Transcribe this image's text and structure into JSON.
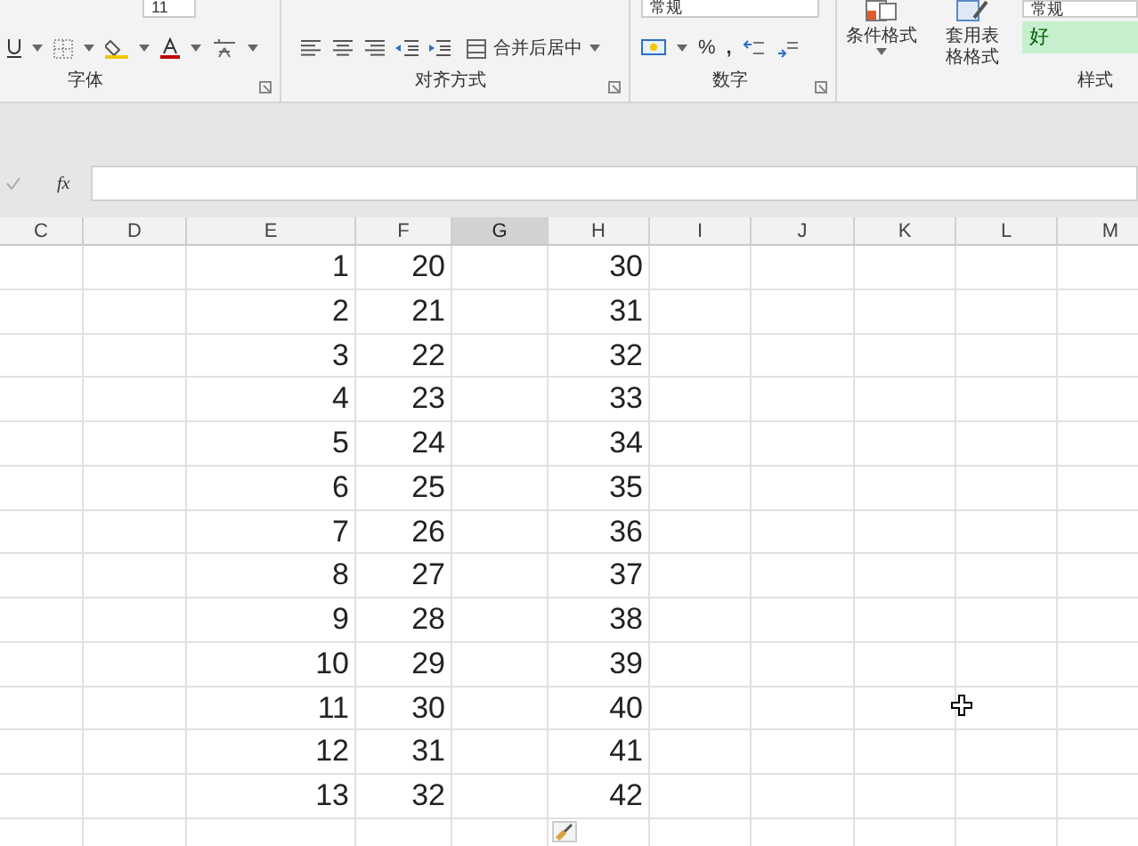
{
  "ribbon": {
    "font_size": "11",
    "number_format": "常规",
    "merge_button": "合并后居中",
    "percent_button": "%",
    "comma_button": ",",
    "conditional_format": "条件格式",
    "format_as_table": "套用表格格式",
    "style_normal": "常规",
    "style_good": "好",
    "groups": [
      "字体",
      "对齐方式",
      "数字",
      "样式"
    ]
  },
  "formula_bar": {
    "fx": "fx"
  },
  "columns": [
    {
      "label": "C",
      "selected": false
    },
    {
      "label": "D",
      "selected": false
    },
    {
      "label": "E",
      "selected": false
    },
    {
      "label": "F",
      "selected": false
    },
    {
      "label": "G",
      "selected": true
    },
    {
      "label": "H",
      "selected": false
    },
    {
      "label": "I",
      "selected": false
    },
    {
      "label": "J",
      "selected": false
    },
    {
      "label": "K",
      "selected": false
    },
    {
      "label": "L",
      "selected": false
    },
    {
      "label": "M",
      "selected": false
    }
  ],
  "rows": [
    {
      "column_e": "1",
      "column_f": "20",
      "column_h": "30"
    },
    {
      "column_e": "2",
      "column_f": "21",
      "column_h": "31"
    },
    {
      "column_e": "3",
      "column_f": "22",
      "column_h": "32"
    },
    {
      "column_e": "4",
      "column_f": "23",
      "column_h": "33"
    },
    {
      "column_e": "5",
      "column_f": "24",
      "column_h": "34"
    },
    {
      "column_e": "6",
      "column_f": "25",
      "column_h": "35"
    },
    {
      "column_e": "7",
      "column_f": "26",
      "column_h": "36"
    },
    {
      "column_e": "8",
      "column_f": "27",
      "column_h": "37"
    },
    {
      "column_e": "9",
      "column_f": "28",
      "column_h": "38"
    },
    {
      "column_e": "10",
      "column_f": "29",
      "column_h": "39"
    },
    {
      "column_e": "11",
      "column_f": "30",
      "column_h": "40"
    },
    {
      "column_e": "12",
      "column_f": "31",
      "column_h": "41"
    },
    {
      "column_e": "13",
      "column_f": "32",
      "column_h": "42"
    }
  ]
}
